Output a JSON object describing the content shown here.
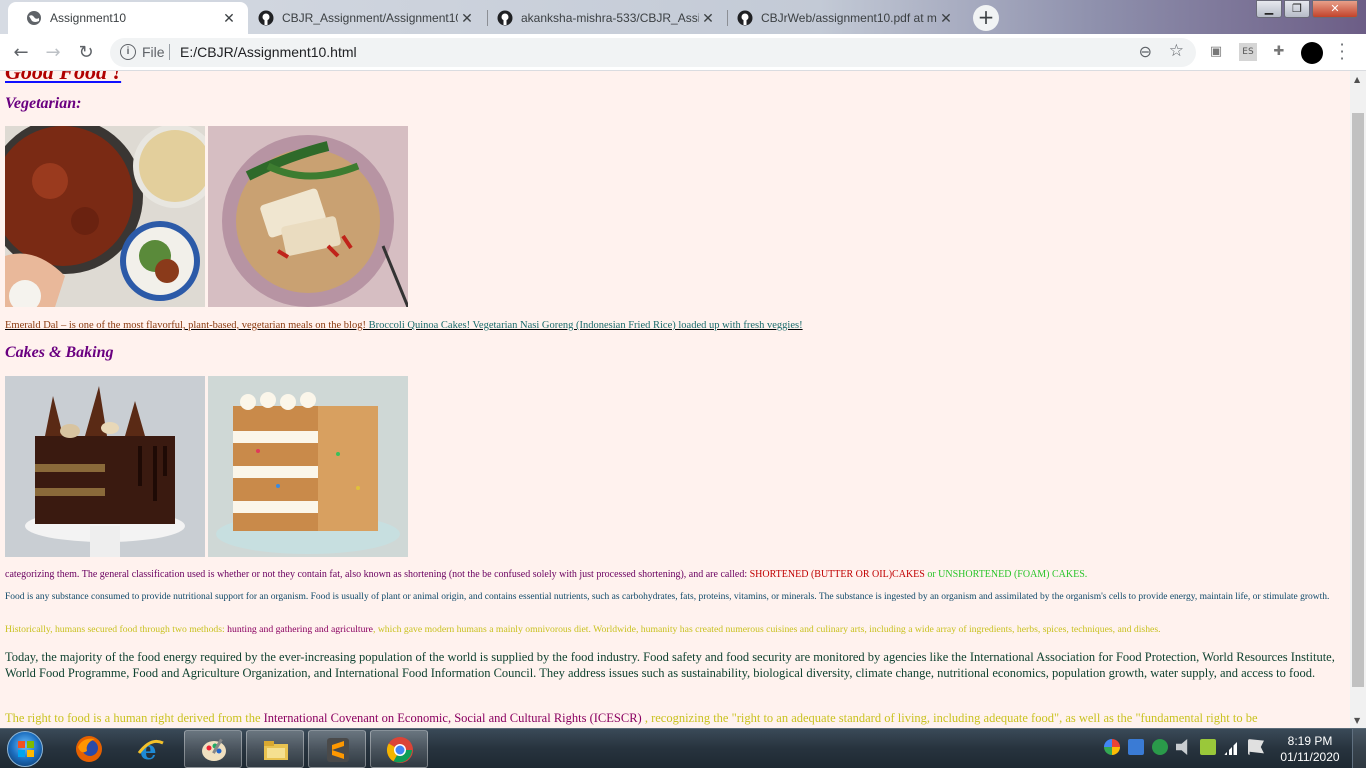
{
  "browser": {
    "tabs": [
      {
        "title": "Assignment10",
        "icon": "globe-icon",
        "active": true
      },
      {
        "title": "CBJR_Assignment/Assignment10",
        "icon": "github-icon",
        "active": false
      },
      {
        "title": "akanksha-mishra-533/CBJR_Assig",
        "icon": "github-icon",
        "active": false
      },
      {
        "title": "CBJrWeb/assignment10.pdf at m",
        "icon": "github-icon",
        "active": false
      }
    ],
    "new_tab_label": "+",
    "close_label": "✕",
    "address": {
      "scheme_label": "File",
      "url": "E:/CBJR/Assignment10.html"
    },
    "extension_labels": [
      "ES"
    ]
  },
  "page": {
    "top_heading": "Good Food !",
    "vegetarian": {
      "heading": "Vegetarian:",
      "caption_brown": "Emerald Dal – is one of the most flavorful, plant-based, vegetarian meals on the blog!",
      "caption_teal": " Broccoli Quinoa Cakes! Vegetarian Nasi Goreng (Indonesian Fried Rice) loaded up with fresh veggies!"
    },
    "cakes": {
      "heading": "Cakes & Baking"
    },
    "p1": {
      "text": "categorizing them. The general classification used is whether or not they contain fat, also known as shortening (not the be confused solely with just processed shortening), and are called: ",
      "red": "SHORTENED (BUTTER OR OIL)CAKES",
      "green": " or UNSHORTENED (FOAM) CAKES."
    },
    "p2": "Food is any substance consumed to provide nutritional support for an organism. Food is usually of plant or animal origin, and contains essential nutrients, such as carbohydrates, fats, proteins, vitamins, or minerals. The substance is ingested by an organism and assimilated by the organism's cells to provide energy, maintain life, or stimulate growth.",
    "p3": {
      "a": "Historically, humans secured food through two methods: ",
      "mag": "hunting and gathering and agriculture",
      "b": ", which gave modern humans a mainly omnivorous diet. Worldwide, humanity has created numerous cuisines and culinary arts, including a wide array of ingredients, herbs, spices, techniques, and dishes."
    },
    "p4": "Today, the majority of the food energy required by the ever-increasing population of the world is supplied by the food industry. Food safety and food security are monitored by agencies like the International Association for Food Protection, World Resources Institute, World Food Programme, Food and Agriculture Organization, and International Food Information Council. They address issues such as sustainability, biological diversity, climate change, nutritional economics, population growth, water supply, and access to food.",
    "p5": {
      "a": "The right to food is a human right derived from the ",
      "mag": "International Covenant on Economic, Social and Cultural Rights (ICESCR)",
      "b": " , recognizing the \"right to an adequate standard of living, including adequate food\", as well as the \"fundamental right to be"
    }
  },
  "taskbar": {
    "apps": [
      "firefox-icon",
      "internet-explorer-icon",
      "paint-icon",
      "file-explorer-icon",
      "sublime-text-icon",
      "chrome-icon"
    ],
    "clock": {
      "time": "8:19 PM",
      "date": "01/11/2020"
    }
  },
  "colors": {
    "page_bg": "#fff2ee",
    "heading_purple": "#6a0080",
    "caption_brown": "#8b3a0f",
    "caption_teal": "#1a6b6b"
  }
}
